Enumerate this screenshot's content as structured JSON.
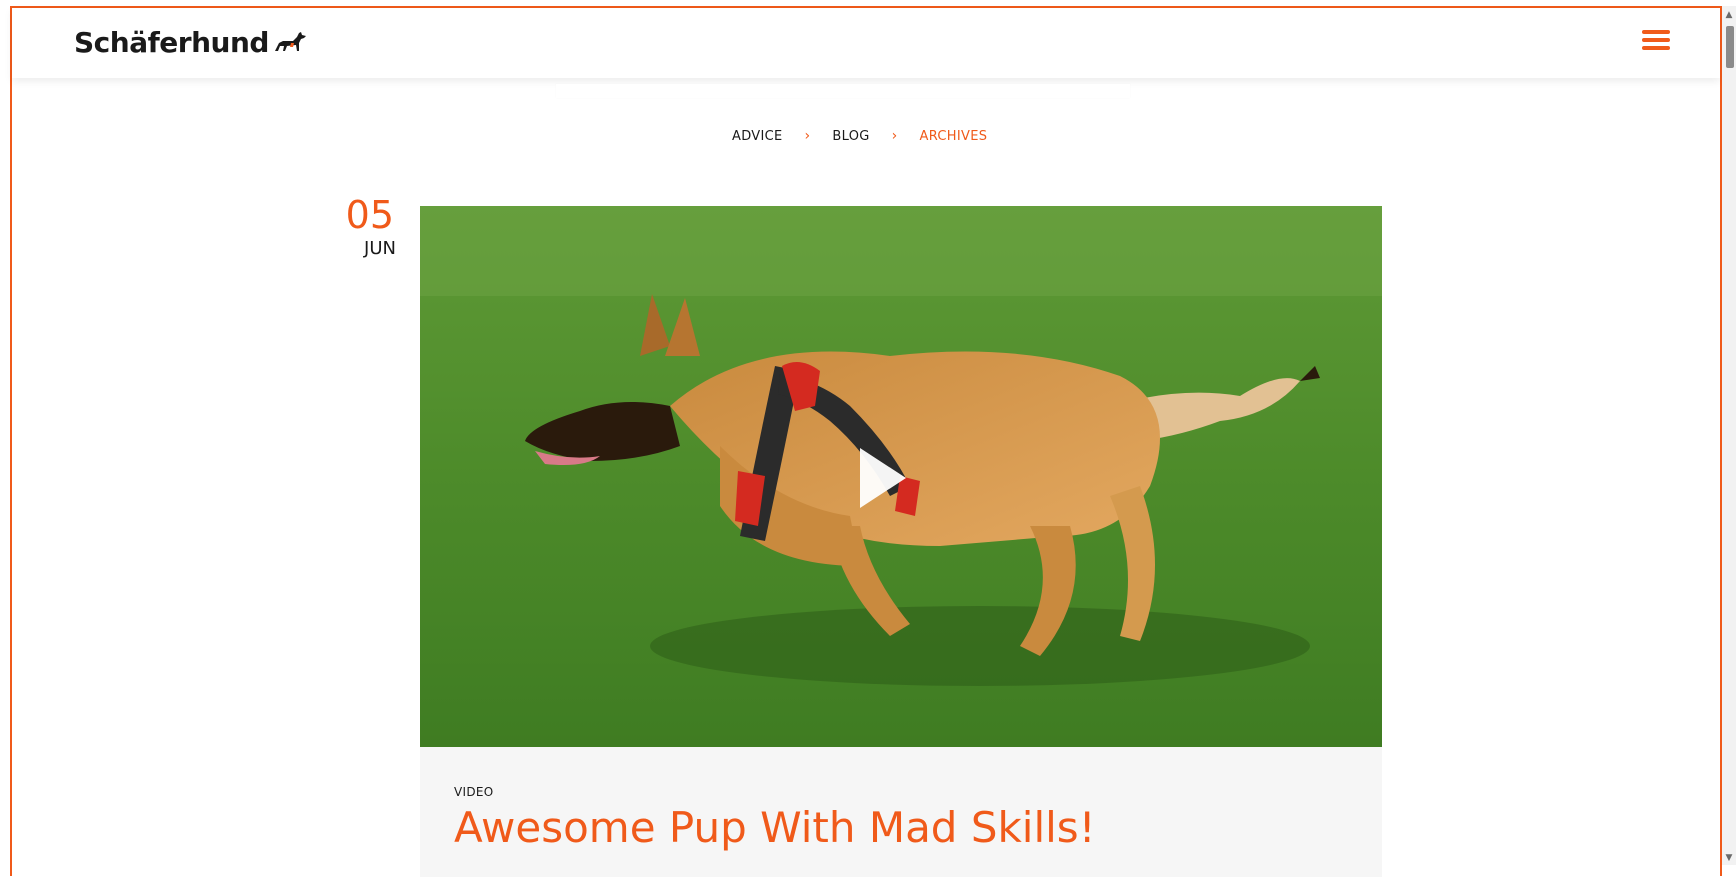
{
  "brand": {
    "name": "Schäferhund",
    "accent_color": "#f05a1a"
  },
  "header": {
    "menu_icon": "hamburger-menu-icon",
    "logo_icon": "shepherd-dog-icon"
  },
  "breadcrumb": {
    "items": [
      "ADVICE",
      "BLOG",
      "ARCHIVES"
    ],
    "separator": "›"
  },
  "post": {
    "day": "05",
    "month": "JUN",
    "category": "VIDEO",
    "title": "Awesome Pup With Mad Skills!",
    "media_icon": "play-icon"
  }
}
